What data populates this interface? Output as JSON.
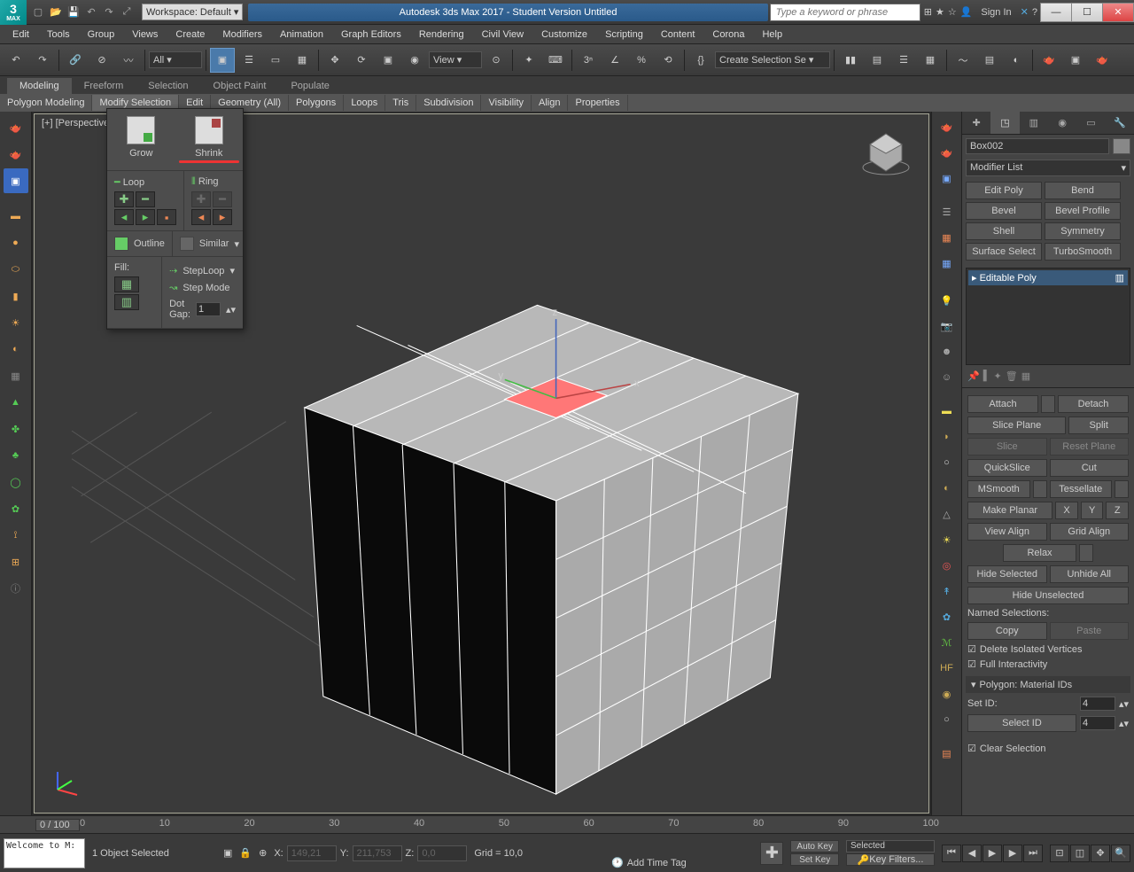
{
  "titlebar": {
    "workspace_label": "Workspace: Default",
    "app_title": "Autodesk 3ds Max 2017 - Student Version   Untitled",
    "search_placeholder": "Type a keyword or phrase",
    "sign_in": "Sign In"
  },
  "menubar": [
    "Edit",
    "Tools",
    "Group",
    "Views",
    "Create",
    "Modifiers",
    "Animation",
    "Graph Editors",
    "Rendering",
    "Civil View",
    "Customize",
    "Scripting",
    "Content",
    "Corona",
    "Help"
  ],
  "maintoolbar": {
    "all_label": "All",
    "view_label": "View",
    "selset_label": "Create Selection Se"
  },
  "ribbon": {
    "tabs": [
      "Modeling",
      "Freeform",
      "Selection",
      "Object Paint",
      "Populate"
    ],
    "active_tab": 0,
    "subtabs": [
      "Polygon Modeling",
      "Modify Selection",
      "Edit",
      "Geometry (All)",
      "Polygons",
      "Loops",
      "Tris",
      "Subdivision",
      "Visibility",
      "Align",
      "Properties"
    ],
    "active_subtab": 1
  },
  "popup": {
    "grow": "Grow",
    "shrink": "Shrink",
    "loop": "Loop",
    "ring": "Ring",
    "outline": "Outline",
    "similar": "Similar",
    "fill": "Fill:",
    "steploop": "StepLoop",
    "stepmode": "Step Mode",
    "dotgap": "Dot Gap:",
    "dotgap_val": "1"
  },
  "viewport": {
    "label": "[+] [Perspective]"
  },
  "cmdpanel": {
    "object_name": "Box002",
    "modifier_list": "Modifier List",
    "mod_buttons": [
      "Edit Poly",
      "Bend",
      "Bevel",
      "Bevel Profile",
      "Shell",
      "Symmetry",
      "Surface Select",
      "TurboSmooth"
    ],
    "stack_item": "Editable Poly",
    "attach": "Attach",
    "detach": "Detach",
    "slice_plane": "Slice Plane",
    "split": "Split",
    "slice": "Slice",
    "reset_plane": "Reset Plane",
    "quickslice": "QuickSlice",
    "cut": "Cut",
    "msmooth": "MSmooth",
    "tessellate": "Tessellate",
    "make_planar": "Make Planar",
    "x": "X",
    "y": "Y",
    "z": "Z",
    "view_align": "View Align",
    "grid_align": "Grid Align",
    "relax": "Relax",
    "hide_selected": "Hide Selected",
    "unhide_all": "Unhide All",
    "hide_unselected": "Hide Unselected",
    "named_selections": "Named Selections:",
    "copy": "Copy",
    "paste": "Paste",
    "delete_isolated": "Delete Isolated Vertices",
    "full_interactivity": "Full Interactivity",
    "rollout_polyids": "Polygon: Material IDs",
    "set_id": "Set ID:",
    "set_id_val": "4",
    "select_id": "Select ID",
    "select_id_val": "4",
    "clear_selection": "Clear Selection"
  },
  "timeline": {
    "scrub": "0 / 100",
    "ticks": [
      "0",
      "10",
      "20",
      "30",
      "40",
      "50",
      "60",
      "70",
      "80",
      "90",
      "100"
    ]
  },
  "status": {
    "prompt": "Welcome to M:",
    "objects_selected": "1 Object Selected",
    "x_label": "X:",
    "x": "149,21",
    "y_label": "Y:",
    "y": "211,753",
    "z_label": "Z:",
    "z": "0,0",
    "grid": "Grid = 10,0",
    "add_time_tag": "Add Time Tag",
    "auto_key": "Auto Key",
    "set_key": "Set Key",
    "selected": "Selected",
    "key_filters": "Key Filters..."
  }
}
